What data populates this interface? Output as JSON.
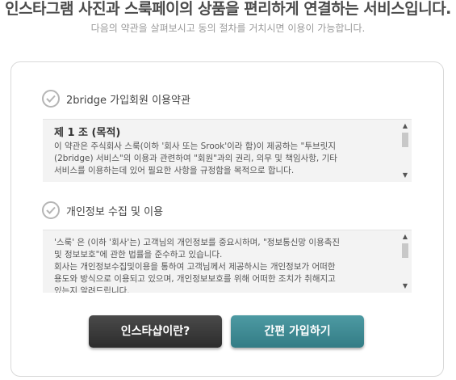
{
  "header": {
    "title": "인스타그램 사진과 스룩페이의 상품을 편리하게 연결하는 서비스입니다.",
    "subtitle": "다음의 약관을 살펴보시고 동의 절차를 거치시면 이용이 가능합니다."
  },
  "sections": [
    {
      "label": "2bridge 가입회원 이용약관",
      "heading": "제 1 조 (목적)",
      "lines": [
        "이 약관은 주식회사 스룩(이하 '회사 또는 Srook'이라 함)이 제공하는 \"투브릿지",
        "(2bridge) 서비스\"의 이용과 관련하여 \"회원\"과의 권리, 의무 및 책임사항, 기타",
        "서비스를 이용하는데 있어 필요한 사항을 규정함을 목적으로 합니다."
      ]
    },
    {
      "label": "개인정보 수집 및 이용",
      "lines": [
        "'스룩' 은 (이하 '회사'는) 고객님의 개인정보를 중요시하며, \"정보통신망 이용촉진",
        "및 정보보호\"에 관한 법률을 준수하고 있습니다.",
        "회사는 개인정보수집및이용을 통하여 고객님께서 제공하시는 개인정보가 어떠한",
        "용도와 방식으로 이용되고 있으며, 개인정보보호를 위해 어떠한 조치가 취해지고",
        "있는지 알려드립니다."
      ]
    }
  ],
  "buttons": {
    "about": "인스타샵이란?",
    "signup": "간편 가입하기"
  },
  "icons": {
    "check": "check-circle-icon",
    "scroll_up": "arrow-up-icon",
    "scroll_down": "arrow-down-icon"
  }
}
